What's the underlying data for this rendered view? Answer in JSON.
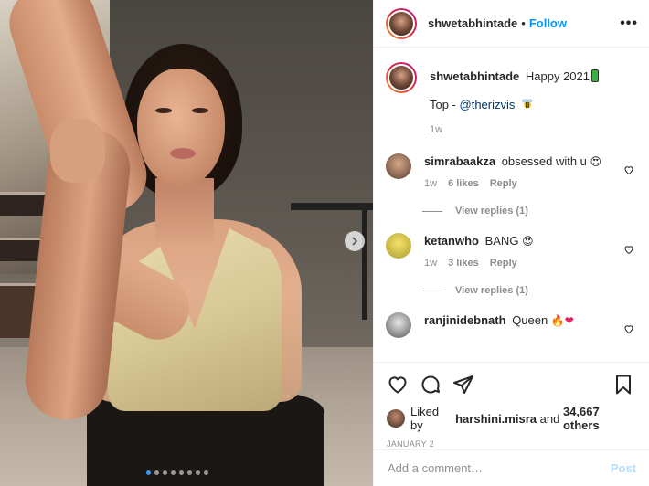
{
  "post": {
    "username": "shwetabhintade",
    "follow_label": "Follow",
    "separator": "•",
    "more_label": "•••"
  },
  "caption": {
    "username": "shwetabhintade",
    "text": "Happy 2021",
    "line2_prefix": "Top - ",
    "mention": "@therizvis",
    "time": "1w"
  },
  "comments": [
    {
      "username": "simrabaakza",
      "text": "obsessed with u",
      "emoji": "😍",
      "time": "1w",
      "likes": "6 likes",
      "reply": "Reply",
      "view_replies": "View replies (1)"
    },
    {
      "username": "ketanwho",
      "text": "BANG",
      "emoji": "😍",
      "time": "1w",
      "likes": "3 likes",
      "reply": "Reply",
      "view_replies": "View replies (1)"
    },
    {
      "username": "ranjinidebnath",
      "text": "Queen",
      "emoji": "🔥❤",
      "time": "",
      "likes": "",
      "reply": "",
      "view_replies": ""
    }
  ],
  "likes": {
    "prefix": "Liked by ",
    "user": "harshini.misra",
    "middle": " and ",
    "others": "34,667 others"
  },
  "date": "JANUARY 2",
  "add_comment": {
    "placeholder": "Add a comment…",
    "post_label": "Post"
  },
  "carousel": {
    "count": 8,
    "active_index": 0
  },
  "colors": {
    "accent": "#0095f6",
    "muted": "#8e8e8e",
    "text": "#262626"
  }
}
